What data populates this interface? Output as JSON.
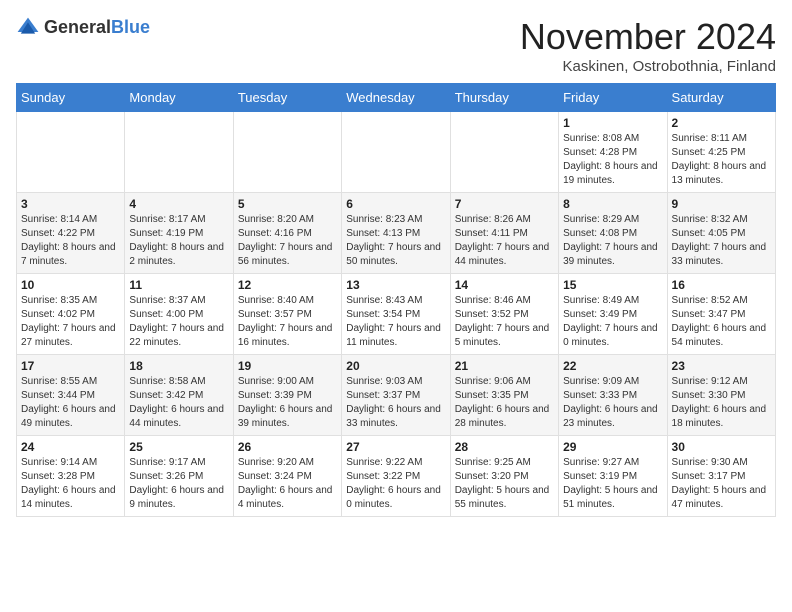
{
  "header": {
    "logo_general": "General",
    "logo_blue": "Blue",
    "month_title": "November 2024",
    "location": "Kaskinen, Ostrobothnia, Finland"
  },
  "weekdays": [
    "Sunday",
    "Monday",
    "Tuesday",
    "Wednesday",
    "Thursday",
    "Friday",
    "Saturday"
  ],
  "weeks": [
    [
      {
        "day": "",
        "sunrise": "",
        "sunset": "",
        "daylight": ""
      },
      {
        "day": "",
        "sunrise": "",
        "sunset": "",
        "daylight": ""
      },
      {
        "day": "",
        "sunrise": "",
        "sunset": "",
        "daylight": ""
      },
      {
        "day": "",
        "sunrise": "",
        "sunset": "",
        "daylight": ""
      },
      {
        "day": "",
        "sunrise": "",
        "sunset": "",
        "daylight": ""
      },
      {
        "day": "1",
        "sunrise": "Sunrise: 8:08 AM",
        "sunset": "Sunset: 4:28 PM",
        "daylight": "Daylight: 8 hours and 19 minutes."
      },
      {
        "day": "2",
        "sunrise": "Sunrise: 8:11 AM",
        "sunset": "Sunset: 4:25 PM",
        "daylight": "Daylight: 8 hours and 13 minutes."
      }
    ],
    [
      {
        "day": "3",
        "sunrise": "Sunrise: 8:14 AM",
        "sunset": "Sunset: 4:22 PM",
        "daylight": "Daylight: 8 hours and 7 minutes."
      },
      {
        "day": "4",
        "sunrise": "Sunrise: 8:17 AM",
        "sunset": "Sunset: 4:19 PM",
        "daylight": "Daylight: 8 hours and 2 minutes."
      },
      {
        "day": "5",
        "sunrise": "Sunrise: 8:20 AM",
        "sunset": "Sunset: 4:16 PM",
        "daylight": "Daylight: 7 hours and 56 minutes."
      },
      {
        "day": "6",
        "sunrise": "Sunrise: 8:23 AM",
        "sunset": "Sunset: 4:13 PM",
        "daylight": "Daylight: 7 hours and 50 minutes."
      },
      {
        "day": "7",
        "sunrise": "Sunrise: 8:26 AM",
        "sunset": "Sunset: 4:11 PM",
        "daylight": "Daylight: 7 hours and 44 minutes."
      },
      {
        "day": "8",
        "sunrise": "Sunrise: 8:29 AM",
        "sunset": "Sunset: 4:08 PM",
        "daylight": "Daylight: 7 hours and 39 minutes."
      },
      {
        "day": "9",
        "sunrise": "Sunrise: 8:32 AM",
        "sunset": "Sunset: 4:05 PM",
        "daylight": "Daylight: 7 hours and 33 minutes."
      }
    ],
    [
      {
        "day": "10",
        "sunrise": "Sunrise: 8:35 AM",
        "sunset": "Sunset: 4:02 PM",
        "daylight": "Daylight: 7 hours and 27 minutes."
      },
      {
        "day": "11",
        "sunrise": "Sunrise: 8:37 AM",
        "sunset": "Sunset: 4:00 PM",
        "daylight": "Daylight: 7 hours and 22 minutes."
      },
      {
        "day": "12",
        "sunrise": "Sunrise: 8:40 AM",
        "sunset": "Sunset: 3:57 PM",
        "daylight": "Daylight: 7 hours and 16 minutes."
      },
      {
        "day": "13",
        "sunrise": "Sunrise: 8:43 AM",
        "sunset": "Sunset: 3:54 PM",
        "daylight": "Daylight: 7 hours and 11 minutes."
      },
      {
        "day": "14",
        "sunrise": "Sunrise: 8:46 AM",
        "sunset": "Sunset: 3:52 PM",
        "daylight": "Daylight: 7 hours and 5 minutes."
      },
      {
        "day": "15",
        "sunrise": "Sunrise: 8:49 AM",
        "sunset": "Sunset: 3:49 PM",
        "daylight": "Daylight: 7 hours and 0 minutes."
      },
      {
        "day": "16",
        "sunrise": "Sunrise: 8:52 AM",
        "sunset": "Sunset: 3:47 PM",
        "daylight": "Daylight: 6 hours and 54 minutes."
      }
    ],
    [
      {
        "day": "17",
        "sunrise": "Sunrise: 8:55 AM",
        "sunset": "Sunset: 3:44 PM",
        "daylight": "Daylight: 6 hours and 49 minutes."
      },
      {
        "day": "18",
        "sunrise": "Sunrise: 8:58 AM",
        "sunset": "Sunset: 3:42 PM",
        "daylight": "Daylight: 6 hours and 44 minutes."
      },
      {
        "day": "19",
        "sunrise": "Sunrise: 9:00 AM",
        "sunset": "Sunset: 3:39 PM",
        "daylight": "Daylight: 6 hours and 39 minutes."
      },
      {
        "day": "20",
        "sunrise": "Sunrise: 9:03 AM",
        "sunset": "Sunset: 3:37 PM",
        "daylight": "Daylight: 6 hours and 33 minutes."
      },
      {
        "day": "21",
        "sunrise": "Sunrise: 9:06 AM",
        "sunset": "Sunset: 3:35 PM",
        "daylight": "Daylight: 6 hours and 28 minutes."
      },
      {
        "day": "22",
        "sunrise": "Sunrise: 9:09 AM",
        "sunset": "Sunset: 3:33 PM",
        "daylight": "Daylight: 6 hours and 23 minutes."
      },
      {
        "day": "23",
        "sunrise": "Sunrise: 9:12 AM",
        "sunset": "Sunset: 3:30 PM",
        "daylight": "Daylight: 6 hours and 18 minutes."
      }
    ],
    [
      {
        "day": "24",
        "sunrise": "Sunrise: 9:14 AM",
        "sunset": "Sunset: 3:28 PM",
        "daylight": "Daylight: 6 hours and 14 minutes."
      },
      {
        "day": "25",
        "sunrise": "Sunrise: 9:17 AM",
        "sunset": "Sunset: 3:26 PM",
        "daylight": "Daylight: 6 hours and 9 minutes."
      },
      {
        "day": "26",
        "sunrise": "Sunrise: 9:20 AM",
        "sunset": "Sunset: 3:24 PM",
        "daylight": "Daylight: 6 hours and 4 minutes."
      },
      {
        "day": "27",
        "sunrise": "Sunrise: 9:22 AM",
        "sunset": "Sunset: 3:22 PM",
        "daylight": "Daylight: 6 hours and 0 minutes."
      },
      {
        "day": "28",
        "sunrise": "Sunrise: 9:25 AM",
        "sunset": "Sunset: 3:20 PM",
        "daylight": "Daylight: 5 hours and 55 minutes."
      },
      {
        "day": "29",
        "sunrise": "Sunrise: 9:27 AM",
        "sunset": "Sunset: 3:19 PM",
        "daylight": "Daylight: 5 hours and 51 minutes."
      },
      {
        "day": "30",
        "sunrise": "Sunrise: 9:30 AM",
        "sunset": "Sunset: 3:17 PM",
        "daylight": "Daylight: 5 hours and 47 minutes."
      }
    ]
  ]
}
